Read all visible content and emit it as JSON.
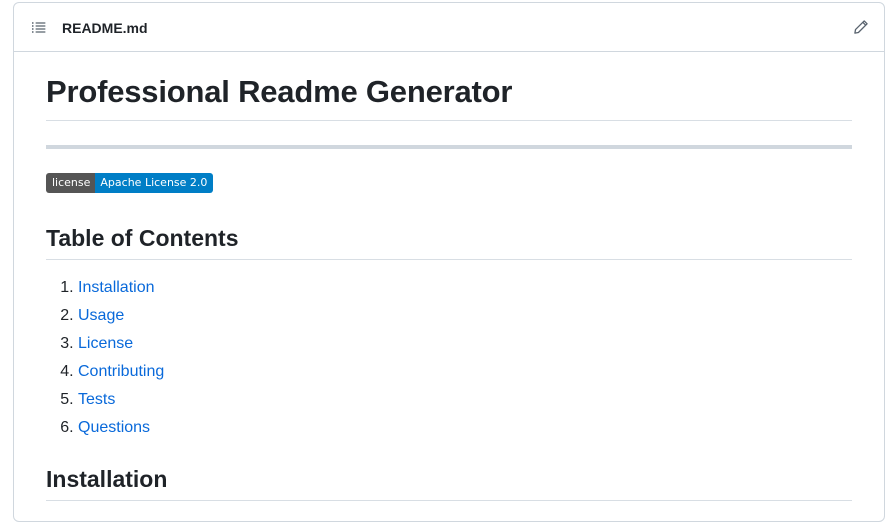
{
  "header": {
    "filename": "README.md",
    "outline_icon": "list-unordered-icon",
    "edit_icon": "pencil-icon"
  },
  "readme": {
    "title": "Professional Readme Generator",
    "badge": {
      "label": "license",
      "message": "Apache License 2.0",
      "label_color": "#555555",
      "message_color": "#007ec6"
    },
    "toc_heading": "Table of Contents",
    "toc_items": [
      {
        "num": "1.",
        "label": "Installation"
      },
      {
        "num": "2.",
        "label": "Usage"
      },
      {
        "num": "3.",
        "label": "License"
      },
      {
        "num": "4.",
        "label": "Contributing"
      },
      {
        "num": "5.",
        "label": "Tests"
      },
      {
        "num": "6.",
        "label": "Questions"
      }
    ],
    "installation_heading": "Installation"
  },
  "colors": {
    "link": "#0969da",
    "text": "#1f2328",
    "border": "#d0d7de"
  }
}
